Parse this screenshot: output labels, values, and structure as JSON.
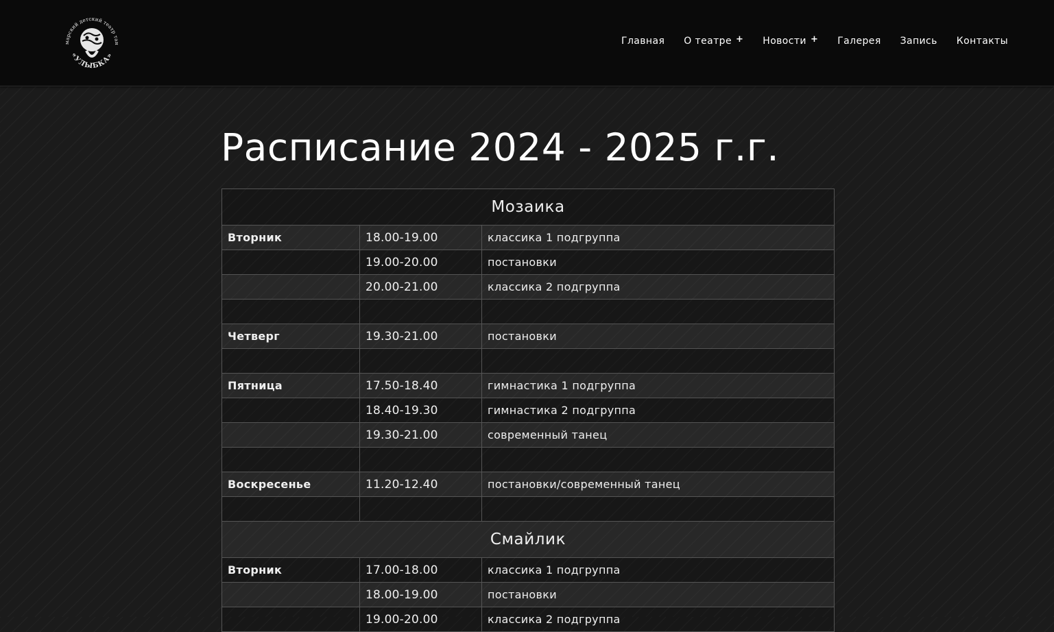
{
  "header": {
    "logo_top_text": "Самарский детский театр танца",
    "logo_bottom_text": "«УЛЫБКА»",
    "nav": [
      {
        "label": "Главная",
        "submenu": false
      },
      {
        "label": "О театре",
        "submenu": true
      },
      {
        "label": "Новости",
        "submenu": true
      },
      {
        "label": "Галерея",
        "submenu": false
      },
      {
        "label": "Запись",
        "submenu": false
      },
      {
        "label": "Контакты",
        "submenu": false
      }
    ],
    "submenu_symbol": "+"
  },
  "page": {
    "title": "Расписание 2024 - 2025 г.г."
  },
  "schedule": {
    "groups": [
      {
        "name": "Мозаика",
        "rows": [
          {
            "day": "Вторник",
            "time": "18.00-19.00",
            "activity": "классика 1 подгруппа"
          },
          {
            "day": "",
            "time": "19.00-20.00",
            "activity": "постановки"
          },
          {
            "day": "",
            "time": "20.00-21.00",
            "activity": "классика 2 подгруппа"
          },
          {
            "day": "",
            "time": "",
            "activity": ""
          },
          {
            "day": "Четверг",
            "time": "19.30-21.00",
            "activity": "постановки"
          },
          {
            "day": "",
            "time": "",
            "activity": ""
          },
          {
            "day": "Пятница",
            "time": "17.50-18.40",
            "activity": "гимнастика 1 подгруппа"
          },
          {
            "day": "",
            "time": "18.40-19.30",
            "activity": "гимнастика 2 подгруппа"
          },
          {
            "day": "",
            "time": "19.30-21.00",
            "activity": "современный танец"
          },
          {
            "day": "",
            "time": "",
            "activity": ""
          },
          {
            "day": "Воскресенье",
            "time": "11.20-12.40",
            "activity": "постановки/современный танец"
          },
          {
            "day": "",
            "time": "",
            "activity": ""
          }
        ]
      },
      {
        "name": "Смайлик",
        "rows": [
          {
            "day": "Вторник",
            "time": "17.00-18.00",
            "activity": "классика 1 подгруппа"
          },
          {
            "day": "",
            "time": "18.00-19.00",
            "activity": "постановки"
          },
          {
            "day": "",
            "time": "19.00-20.00",
            "activity": "классика 2 подгруппа"
          }
        ]
      }
    ]
  }
}
